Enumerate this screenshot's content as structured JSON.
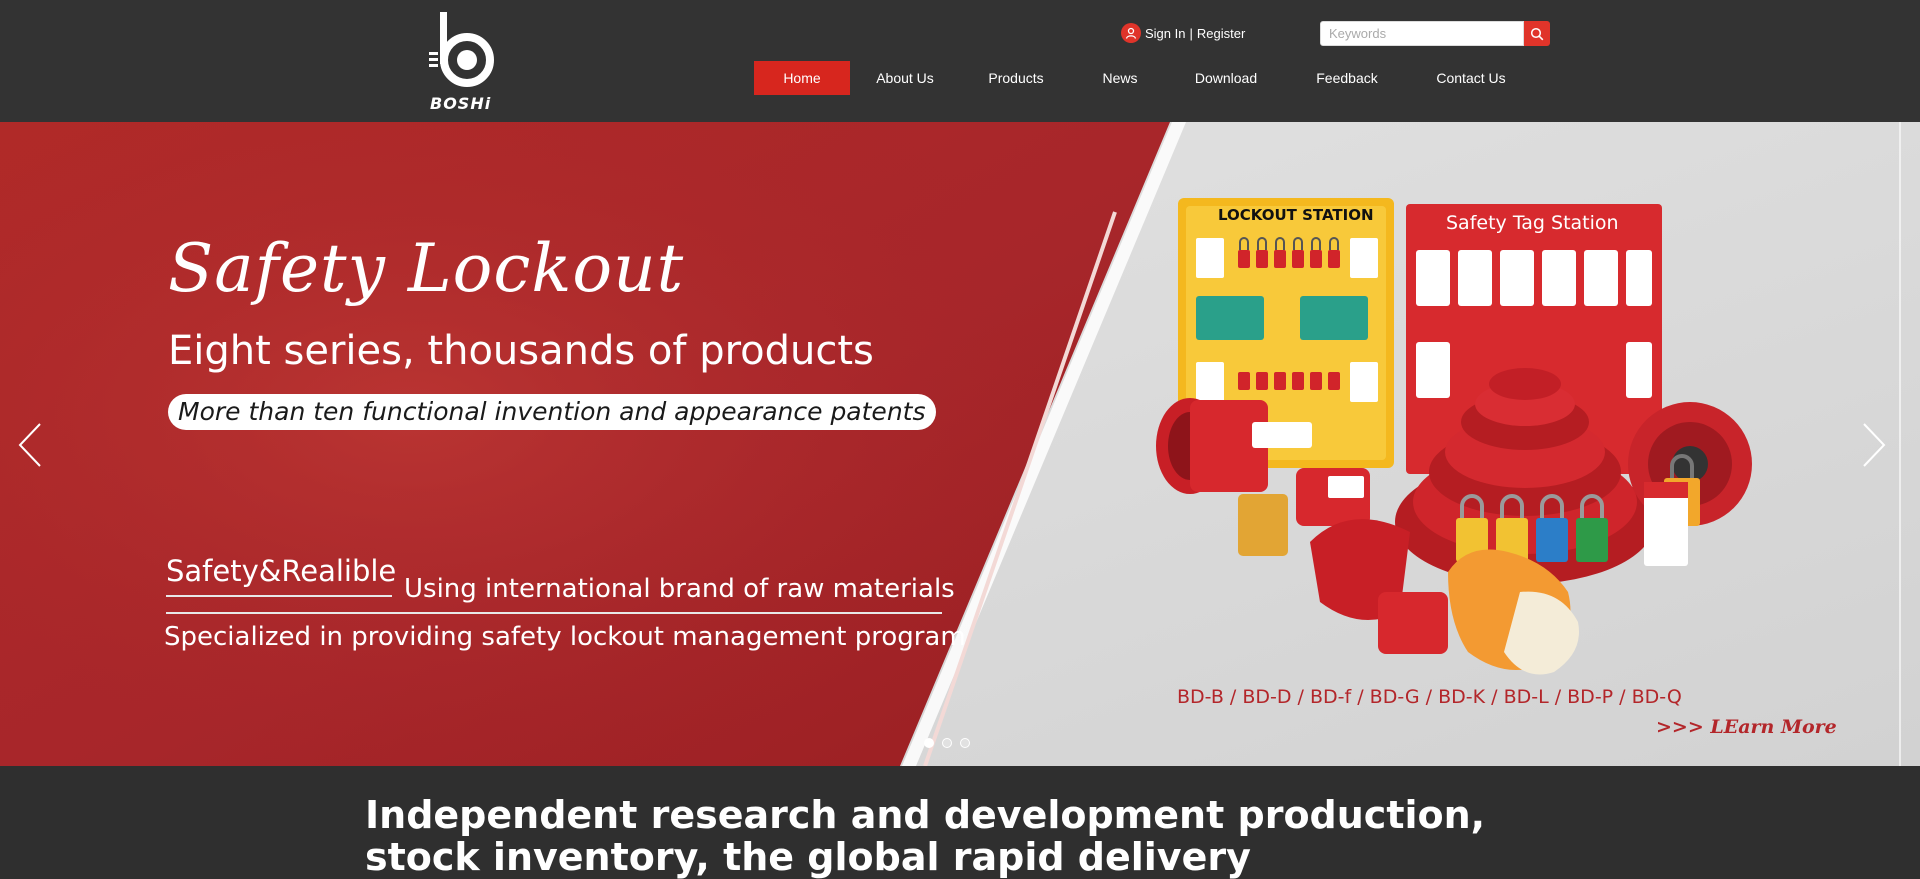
{
  "brand": {
    "name": "BOSHi",
    "accent": "#d7261e",
    "header_bg": "#333333"
  },
  "account": {
    "sign_in": "Sign In",
    "separator": "|",
    "register": "Register",
    "icon": "user-icon"
  },
  "search": {
    "placeholder": "Keywords",
    "icon": "search-icon"
  },
  "nav": {
    "items": [
      {
        "label": "Home",
        "active": true
      },
      {
        "label": "About Us"
      },
      {
        "label": "Products"
      },
      {
        "label": "News"
      },
      {
        "label": "Download"
      },
      {
        "label": "Feedback"
      },
      {
        "label": "Contact Us"
      }
    ]
  },
  "banner": {
    "title": "Safety Lockout",
    "subtitle": "Eight series, thousands of products",
    "patents": "More than ten functional invention and appearance patents",
    "safety": "Safety&Realible",
    "materials": "Using international brand of raw materials",
    "specialized": "Specialized in providing safety lockout management program",
    "lockout_station": "LOCKOUT STATION",
    "tag_station": "Safety Tag Station",
    "series": "BD-B / BD-D / BD-f / BD-G / BD-K / BD-L / BD-P / BD-Q",
    "learn_more": ">>> LEarn More",
    "prev_icon": "chevron-left-icon",
    "next_icon": "chevron-right-icon",
    "slides": 3,
    "active_slide": 1
  },
  "section": {
    "headline": "Independent research and development production, stock inventory, the global rapid delivery"
  }
}
